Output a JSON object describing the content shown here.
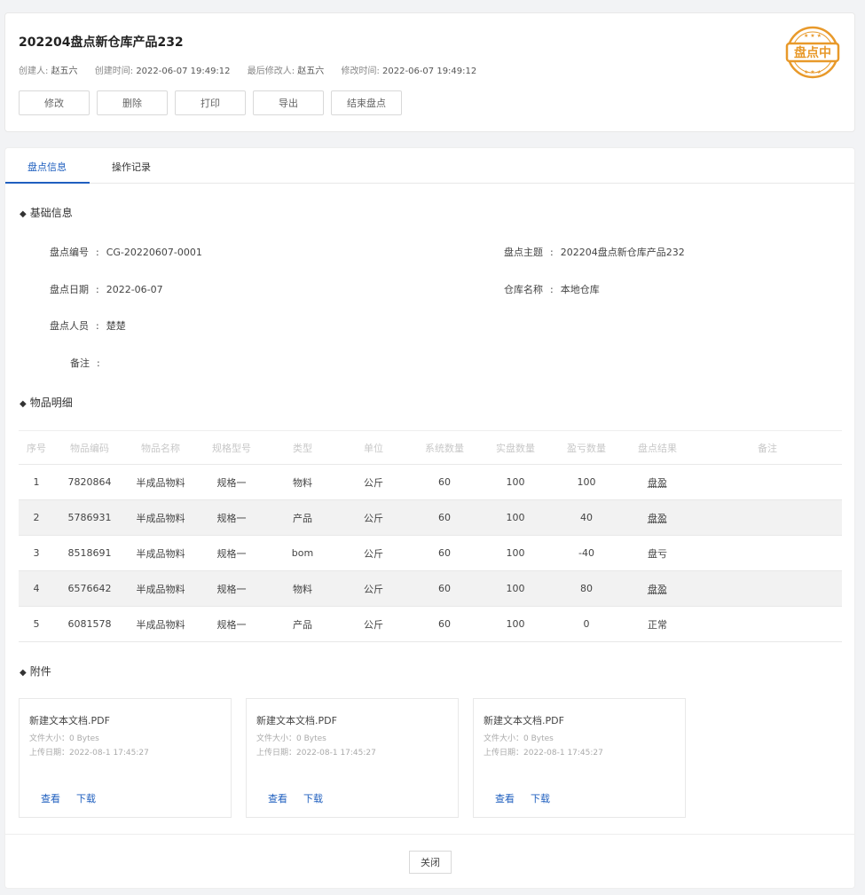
{
  "header": {
    "title": "202204盘点新仓库产品232",
    "meta": [
      {
        "label": "创建人:",
        "value": "赵五六"
      },
      {
        "label": "创建时间:",
        "value": "2022-06-07 19:49:12"
      },
      {
        "label": "最后修改人:",
        "value": "赵五六"
      },
      {
        "label": "修改时间:",
        "value": "2022-06-07 19:49:12"
      }
    ],
    "actions": [
      "修改",
      "删除",
      "打印",
      "导出",
      "结束盘点"
    ],
    "stamp_text": "盘点中",
    "stamp_color": "#e8992a"
  },
  "tabs": [
    "盘点信息",
    "操作记录"
  ],
  "basic": {
    "title": "基础信息",
    "fields": [
      {
        "label": "盘点编号",
        "value": "CG-20220607-0001"
      },
      {
        "label": "盘点主题",
        "value": "202204盘点新仓库产品232"
      },
      {
        "label": "盘点日期",
        "value": "2022-06-07"
      },
      {
        "label": "仓库名称",
        "value": "本地仓库"
      },
      {
        "label": "盘点人员",
        "value": "楚楚"
      },
      {
        "label": "备注",
        "value": ""
      }
    ]
  },
  "items": {
    "title": "物品明细",
    "columns": [
      "序号",
      "物品编码",
      "物品名称",
      "规格型号",
      "类型",
      "单位",
      "系统数量",
      "实盘数量",
      "盈亏数量",
      "盘点结果",
      "备注"
    ],
    "rows": [
      [
        "1",
        "7820864",
        "半成品物料",
        "规格一",
        "物料",
        "公斤",
        "60",
        "100",
        "100",
        "盘盈",
        ""
      ],
      [
        "2",
        "5786931",
        "半成品物料",
        "规格一",
        "产品",
        "公斤",
        "60",
        "100",
        "40",
        "盘盈",
        ""
      ],
      [
        "3",
        "8518691",
        "半成品物料",
        "规格一",
        "bom",
        "公斤",
        "60",
        "100",
        "-40",
        "盘亏",
        ""
      ],
      [
        "4",
        "6576642",
        "半成品物料",
        "规格一",
        "物料",
        "公斤",
        "60",
        "100",
        "80",
        "盘盈",
        ""
      ],
      [
        "5",
        "6081578",
        "半成品物料",
        "规格一",
        "产品",
        "公斤",
        "60",
        "100",
        "0",
        "正常",
        ""
      ]
    ]
  },
  "attachments": {
    "title": "附件",
    "files": [
      {
        "name": "新建文本文档.PDF",
        "size": "文件大小：0 Bytes",
        "date": "上传日期：2022-08-1 17:45:27",
        "view": "查看",
        "download": "下载"
      },
      {
        "name": "新建文本文档.PDF",
        "size": "文件大小：0 Bytes",
        "date": "上传日期：2022-08-1 17:45:27",
        "view": "查看",
        "download": "下载"
      },
      {
        "name": "新建文本文档.PDF",
        "size": "文件大小：0 Bytes",
        "date": "上传日期：2022-08-1 17:45:27",
        "view": "查看",
        "download": "下载"
      }
    ]
  },
  "footer": {
    "close_label": "关闭"
  },
  "colors": {
    "accent": "#1f5fbf",
    "stamp": "#e8992a"
  }
}
